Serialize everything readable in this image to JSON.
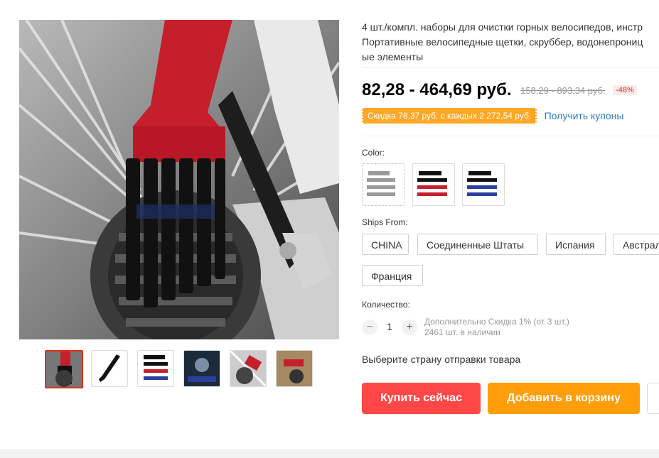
{
  "product": {
    "title_lines": [
      "4 шт./компл. наборы для очистки горных велосипедов, инстр",
      "Портативные велосипедные щетки, скруббер, водонепрониц",
      "ые элементы"
    ],
    "price_range": "82,28 - 464,69 руб.",
    "old_price_range": "158,29 - 893,34 руб.",
    "discount": "-48%",
    "coupon_text": "Скидка 78,37 руб. с каждых 2 272,54 руб.",
    "get_coupons": "Получить купоны"
  },
  "gallery": {
    "thumbnail_count": 6,
    "active_index": 0
  },
  "color": {
    "label": "Color:",
    "options": [
      "silver",
      "red",
      "blue"
    ]
  },
  "ships_from": {
    "label": "Ships From:",
    "options": [
      "CHINA",
      "Соединенные Штаты",
      "Испания",
      "Австрал",
      "Франция"
    ]
  },
  "quantity": {
    "label": "Количество:",
    "value": "1",
    "minus": "−",
    "plus": "+",
    "note_line1": "Дополнительно Скидка 1% (от 3 шт.)",
    "note_line2": "2461 шт. в наличии"
  },
  "ship_country_prompt": "Выберите страну отправки товара",
  "actions": {
    "buy_now": "Купить сейчас",
    "add_to_cart": "Добавить в корзину"
  },
  "colors": {
    "buy": "#ff4747",
    "cart": "#ff9d0a",
    "coupon": "#fda42c",
    "link": "#2e7fb8",
    "discount": "#e22d1f"
  }
}
